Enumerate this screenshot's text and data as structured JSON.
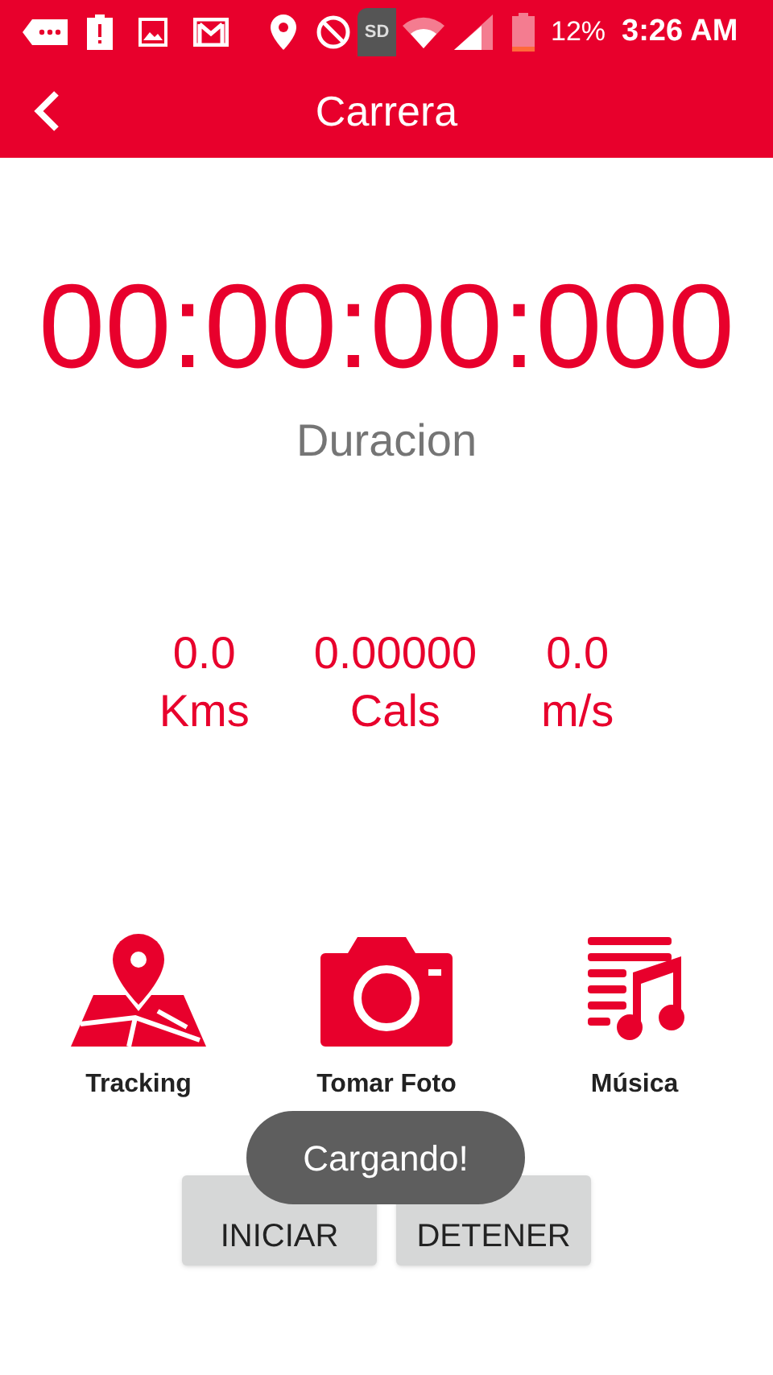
{
  "status_bar": {
    "sd_card": "SD",
    "battery": "12%",
    "time": "3:26 AM"
  },
  "app_bar": {
    "title": "Carrera"
  },
  "timer": {
    "value": "00:00:00:000",
    "label": "Duracion"
  },
  "stats": [
    {
      "value": "0.0",
      "unit": "Kms"
    },
    {
      "value": "0.00000",
      "unit": "Cals"
    },
    {
      "value": "0.0",
      "unit": "m/s"
    }
  ],
  "actions": [
    {
      "kind": "map",
      "label": "Tracking"
    },
    {
      "kind": "camera",
      "label": "Tomar Foto"
    },
    {
      "kind": "music",
      "label": "Música"
    }
  ],
  "buttons": [
    "INICIAR",
    "DETENER"
  ],
  "toast": "Cargando!"
}
